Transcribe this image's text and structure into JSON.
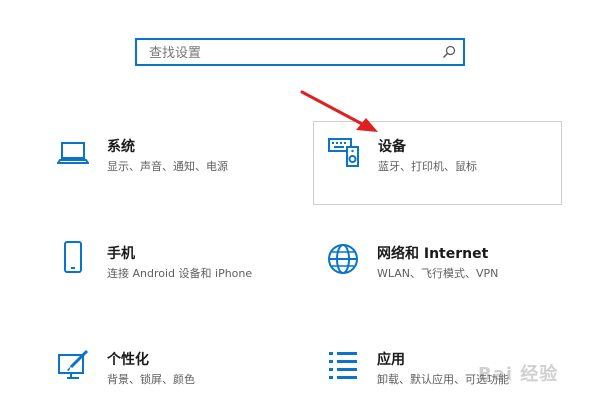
{
  "search": {
    "placeholder": "查找设置"
  },
  "tiles": [
    {
      "title": "系统",
      "desc": "显示、声音、通知、电源",
      "icon": "laptop-icon"
    },
    {
      "title": "设备",
      "desc": "蓝牙、打印机、鼠标",
      "icon": "keyboard-speaker-icon"
    },
    {
      "title": "手机",
      "desc": "连接 Android 设备和 iPhone",
      "icon": "phone-icon"
    },
    {
      "title": "网络和 Internet",
      "desc": "WLAN、飞行模式、VPN",
      "icon": "globe-icon"
    },
    {
      "title": "个性化",
      "desc": "背景、锁屏、颜色",
      "icon": "paint-brush-icon"
    },
    {
      "title": "应用",
      "desc": "卸载、默认应用、可选功能",
      "icon": "app-list-icon"
    }
  ],
  "watermark": "Bai 经验",
  "colors": {
    "accent": "#0a74c9",
    "arrow": "#e02020"
  }
}
